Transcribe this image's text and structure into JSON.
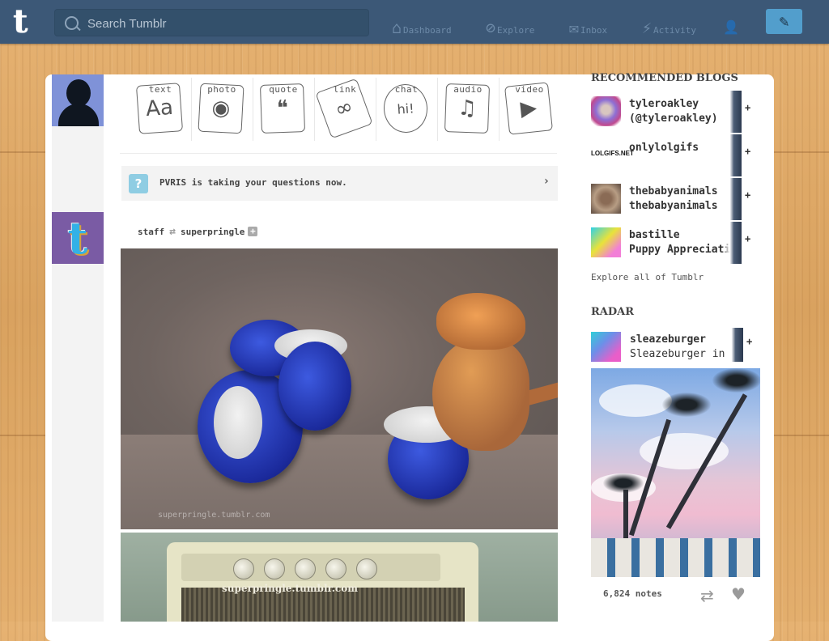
{
  "header": {
    "logo": "t",
    "search_placeholder": "Search Tumblr",
    "nav": [
      {
        "label": "Dashboard",
        "icon": "home-icon",
        "glyph": "⌂"
      },
      {
        "label": "Explore",
        "icon": "compass-icon",
        "glyph": "⊘"
      },
      {
        "label": "Inbox",
        "icon": "envelope-icon",
        "glyph": "✉"
      },
      {
        "label": "Activity",
        "icon": "lightning-icon",
        "glyph": "⚡"
      },
      {
        "label": "",
        "icon": "account-icon",
        "glyph": "👤"
      }
    ],
    "compose_glyph": "✎"
  },
  "post_types": [
    {
      "label": "text",
      "glyph": "Aa"
    },
    {
      "label": "photo",
      "glyph": "◉"
    },
    {
      "label": "quote",
      "glyph": "❝"
    },
    {
      "label": "link",
      "glyph": "∞"
    },
    {
      "label": "chat",
      "glyph": "hi!"
    },
    {
      "label": "audio",
      "glyph": "♫"
    },
    {
      "label": "video",
      "glyph": "▶"
    }
  ],
  "notice": {
    "icon": "?",
    "text": "PVRIS is taking your questions now.",
    "chevron": "›"
  },
  "post": {
    "author": "staff",
    "reblog_glyph": "⇄",
    "reblogged_from": "superpringle",
    "plus": "+",
    "photo1_watermark": "superpringle.tumblr.com",
    "photo2_watermark": "superpringle.tumblr.com"
  },
  "sidebar": {
    "recommended_title": "RECOMMENDED BLOGS",
    "blogs": [
      {
        "name": "tyleroakley",
        "subtitle": "(@tyleroakley)",
        "follow": "+"
      },
      {
        "name": "onlylolgifs",
        "subtitle": "",
        "follow": "+",
        "avatar_text": "LOLGIFS.NET"
      },
      {
        "name": "thebabyanimals",
        "subtitle": "thebabyanimals",
        "follow": "+"
      },
      {
        "name": "bastille",
        "subtitle": "Puppy Appreciation",
        "follow": "+"
      }
    ],
    "explore_link": "Explore all of Tumblr",
    "radar_title": "RADAR",
    "radar_blog": {
      "name": "sleazeburger",
      "subtitle": "Sleazeburger in Paradise",
      "follow": "+"
    },
    "notes": "6,824 notes",
    "reblog_glyph": "⇄",
    "like_glyph": "♥"
  },
  "colors": {
    "header": "#3c5877",
    "compose": "#529ecc",
    "accent_blue": "#529ecc"
  }
}
